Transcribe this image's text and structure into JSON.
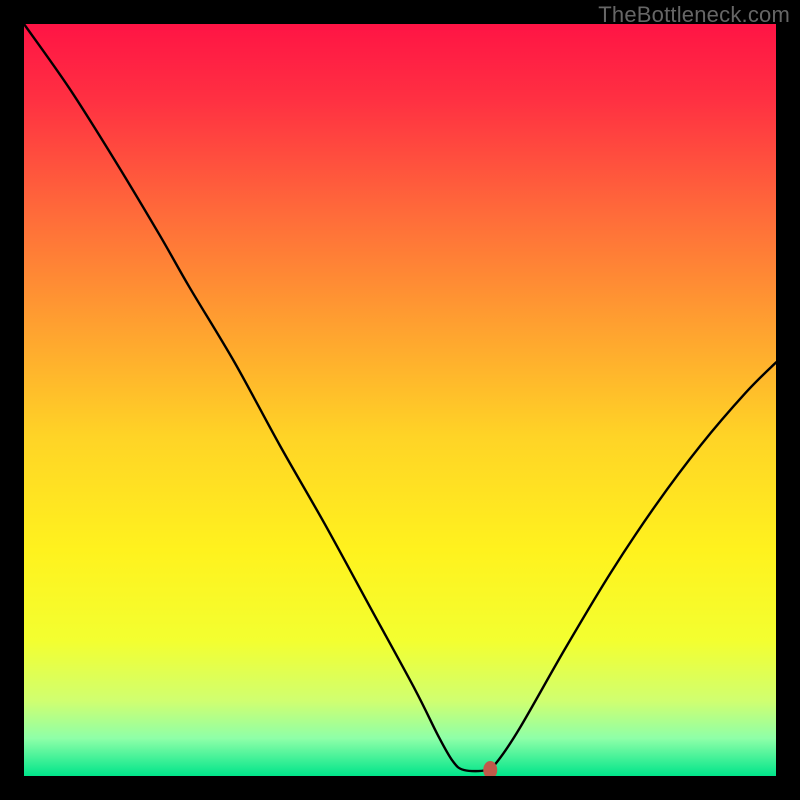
{
  "watermark": "TheBottleneck.com",
  "chart_data": {
    "type": "line",
    "title": "",
    "xlabel": "",
    "ylabel": "",
    "xlim": [
      0,
      100
    ],
    "ylim": [
      0,
      100
    ],
    "background": {
      "type": "vertical-gradient",
      "stops": [
        {
          "offset": 0.0,
          "color": "#ff1445"
        },
        {
          "offset": 0.1,
          "color": "#ff3042"
        },
        {
          "offset": 0.25,
          "color": "#ff6a3a"
        },
        {
          "offset": 0.4,
          "color": "#ffa030"
        },
        {
          "offset": 0.55,
          "color": "#ffd426"
        },
        {
          "offset": 0.7,
          "color": "#fff21e"
        },
        {
          "offset": 0.82,
          "color": "#f3ff30"
        },
        {
          "offset": 0.9,
          "color": "#d0ff70"
        },
        {
          "offset": 0.95,
          "color": "#8effa8"
        },
        {
          "offset": 1.0,
          "color": "#00e58a"
        }
      ]
    },
    "curve": {
      "comment": "Approximate bottleneck curve. x in [0,100]; y is percent bottleneck (0 at optimum).",
      "points": [
        {
          "x": 0.0,
          "y": 100.0
        },
        {
          "x": 6.0,
          "y": 91.5
        },
        {
          "x": 12.0,
          "y": 82.0
        },
        {
          "x": 18.0,
          "y": 72.0
        },
        {
          "x": 22.0,
          "y": 65.0
        },
        {
          "x": 28.0,
          "y": 55.0
        },
        {
          "x": 34.0,
          "y": 44.0
        },
        {
          "x": 40.0,
          "y": 33.5
        },
        {
          "x": 46.0,
          "y": 22.5
        },
        {
          "x": 52.0,
          "y": 11.5
        },
        {
          "x": 55.0,
          "y": 5.5
        },
        {
          "x": 57.0,
          "y": 2.0
        },
        {
          "x": 58.5,
          "y": 0.8
        },
        {
          "x": 61.5,
          "y": 0.8
        },
        {
          "x": 63.0,
          "y": 2.0
        },
        {
          "x": 66.0,
          "y": 6.5
        },
        {
          "x": 72.0,
          "y": 17.0
        },
        {
          "x": 78.0,
          "y": 27.0
        },
        {
          "x": 84.0,
          "y": 36.0
        },
        {
          "x": 90.0,
          "y": 44.0
        },
        {
          "x": 96.0,
          "y": 51.0
        },
        {
          "x": 100.0,
          "y": 55.0
        }
      ]
    },
    "marker": {
      "x": 62.0,
      "y": 0.8,
      "color": "#c05a4a",
      "rx": 7,
      "ry": 9
    }
  }
}
